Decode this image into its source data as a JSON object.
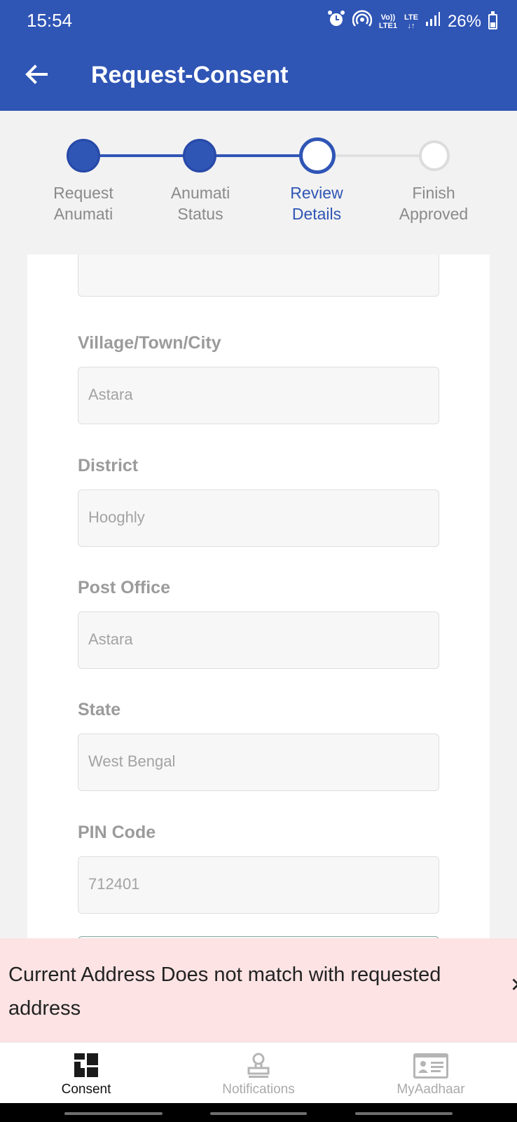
{
  "status_bar": {
    "time": "15:54",
    "network_top": "Vo))",
    "network_bottom": "LTE1",
    "lte_top": "LTE",
    "lte_bottom": "↓↑",
    "battery_percent": "26%"
  },
  "app_bar": {
    "title": "Request-Consent"
  },
  "stepper": {
    "steps": [
      {
        "line1": "Request",
        "line2": "Anumati",
        "state": "done"
      },
      {
        "line1": "Anumati",
        "line2": "Status",
        "state": "done"
      },
      {
        "line1": "Review",
        "line2": "Details",
        "state": "current"
      },
      {
        "line1": "Finish",
        "line2": "Approved",
        "state": "pending"
      }
    ]
  },
  "form": {
    "fields": [
      {
        "label": "Village/Town/City",
        "value": "Astara"
      },
      {
        "label": "District",
        "value": "Hooghly"
      },
      {
        "label": "Post Office",
        "value": "Astara"
      },
      {
        "label": "State",
        "value": "West Bengal"
      },
      {
        "label": "PIN Code",
        "value": "712401"
      }
    ]
  },
  "error_banner": {
    "message": "Current Address Does not match with requested address",
    "close_glyph": "✕"
  },
  "bottom_nav": {
    "items": [
      {
        "label": "Consent",
        "icon": "dashboard-icon",
        "active": true
      },
      {
        "label": "Notifications",
        "icon": "stamp-icon",
        "active": false
      },
      {
        "label": "MyAadhaar",
        "icon": "id-card-icon",
        "active": false
      }
    ]
  },
  "colors": {
    "primary": "#2f55b5",
    "error_bg": "#fde3e4",
    "inactive": "#aaaaaa"
  }
}
